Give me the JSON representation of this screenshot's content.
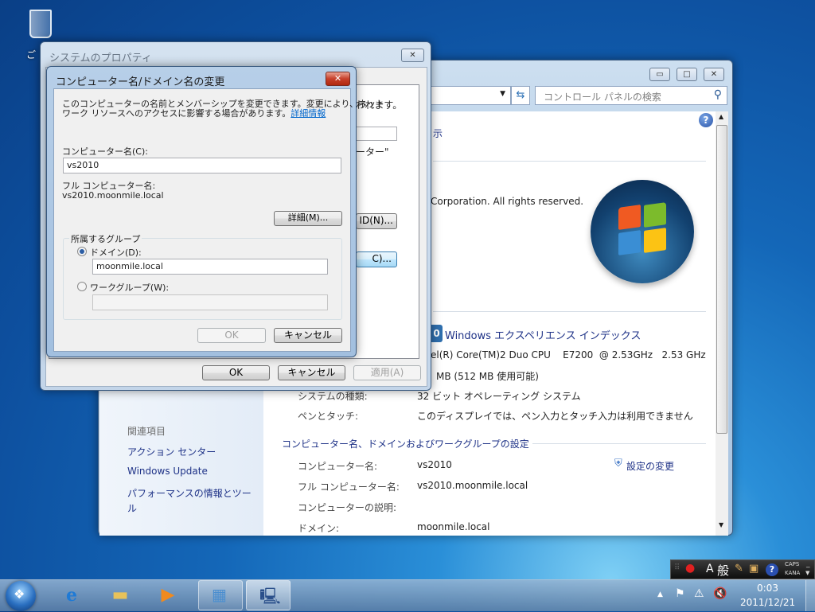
{
  "desktop": {
    "recycle_bin_label": "ご"
  },
  "control_panel": {
    "search_placeholder": "コントロール パネルの検索",
    "caption": {
      "minimize": "▭",
      "maximize": "□",
      "close": "✕"
    },
    "partial_view_link": "示",
    "copyright": "Corporation.  All rights reserved.",
    "wei_badge": "0",
    "wei_link": "Windows エクスペリエンス インデックス",
    "cpu": "el(R) Core(TM)2 Duo CPU    E7200  @ 2.53GHz   2.53 GHz",
    "memory": "MB (512 MB 使用可能)",
    "system_rows": [
      {
        "label": "システムの種類:",
        "value": "32 ビット オペレーティング システム"
      },
      {
        "label": "ペンとタッチ:",
        "value": "このディスプレイでは、ペン入力とタッチ入力は利用できません"
      }
    ],
    "name_section_title": "コンピューター名、ドメインおよびワークグループの設定",
    "name_rows": [
      {
        "label": "コンピューター名:",
        "value": "vs2010"
      },
      {
        "label": "フル コンピューター名:",
        "value": "vs2010.moonmile.local"
      },
      {
        "label": "コンピューターの説明:",
        "value": ""
      },
      {
        "label": "ドメイン:",
        "value": "moonmile.local"
      }
    ],
    "change_settings_link": "設定の変更",
    "sidebar": {
      "heading": "関連項目",
      "items": [
        "アクション センター",
        "Windows Update",
        "パフォーマンスの情報とツー",
        "ル"
      ]
    }
  },
  "system_properties": {
    "title": "システムのプロパティ",
    "close": "✕",
    "partial_text1": "われます。",
    "partial_text2": "ーター\"",
    "partial_button1": "ID(N)...",
    "partial_button2": "C)...",
    "ok": "OK",
    "cancel": "キャンセル",
    "apply": "適用(A)"
  },
  "rename_dialog": {
    "title": "コンピューター名/ドメイン名の変更",
    "close": "✕",
    "description_line1": "このコンピューターの名前とメンバーシップを変更できます。変更により、ネット",
    "description_line2": "ワーク リソースへのアクセスに影響する場合があります。",
    "more_info_link": "詳細情報",
    "computer_name_label": "コンピューター名(C):",
    "computer_name_value": "vs2010",
    "full_name_label": "フル コンピューター名:",
    "full_name_value": "vs2010.moonmile.local",
    "more_button": "詳細(M)...",
    "member_of_label": "所属するグループ",
    "domain_label": "ドメイン(D):",
    "domain_value": "moonmile.local",
    "workgroup_label": "ワークグループ(W):",
    "workgroup_value": "",
    "ok": "OK",
    "cancel": "キャンセル"
  },
  "language_bar": {
    "mode": "A",
    "ime": "般",
    "caps": "CAPS",
    "kana": "KANA"
  },
  "taskbar": {
    "clock_time": "0:03",
    "clock_date": "2011/12/21"
  }
}
